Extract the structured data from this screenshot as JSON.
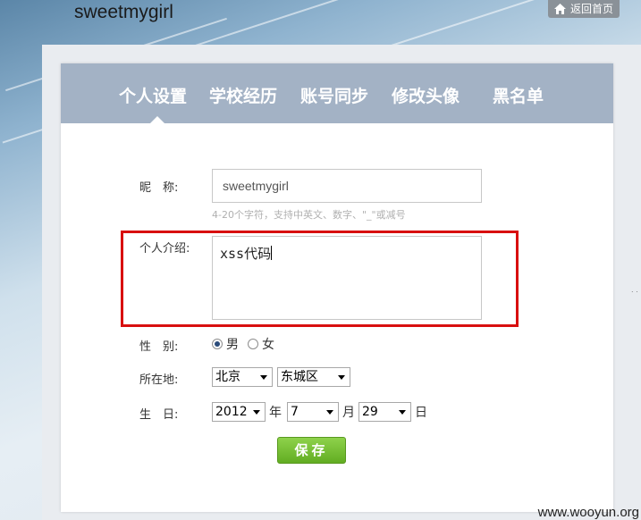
{
  "site": {
    "title": "sweetmygirl",
    "home_label": "返回首页"
  },
  "tabs": [
    {
      "label": "个人设置"
    },
    {
      "label": "学校经历"
    },
    {
      "label": "账号同步"
    },
    {
      "label": "修改头像"
    },
    {
      "label": "黑名单"
    }
  ],
  "form": {
    "nickname_label": "昵　称:",
    "nickname_value": "sweetmygirl",
    "nickname_hint": "4-20个字符，支持中英文、数字、\"_\"或减号",
    "bio_label": "个人介绍:",
    "bio_value": "xss代码",
    "gender_label": "性　别:",
    "gender_male": "男",
    "gender_female": "女",
    "gender_selected": "男",
    "location_label": "所在地:",
    "location_city": "北京",
    "location_district": "东城区",
    "birthday_label": "生　日:",
    "birth_year": "2012",
    "year_unit": "年",
    "birth_month": "7",
    "month_unit": "月",
    "birth_day": "29",
    "day_unit": "日",
    "save_label": "保存"
  },
  "watermark": "www.wooyun.org",
  "colors": {
    "tabbar": "#a3b2c5",
    "highlight": "#d80f0f",
    "save": "#7cc13a"
  }
}
